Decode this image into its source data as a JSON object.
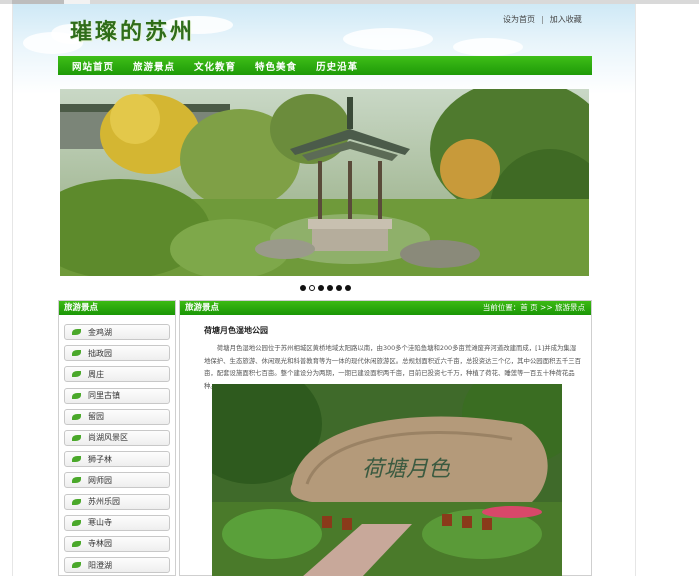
{
  "header": {
    "logo_text": "璀璨的苏州",
    "top_links": [
      "设为首页",
      "|",
      "加入收藏"
    ]
  },
  "nav": {
    "items": [
      "网站首页",
      "旅游景点",
      "文化教育",
      "特色美食",
      "历史沿革"
    ]
  },
  "slider": {
    "dot_count": 6,
    "active_index": 1
  },
  "sidebar": {
    "title": "旅游景点",
    "items": [
      "金鸡湖",
      "拙政园",
      "周庄",
      "同里古镇",
      "留园",
      "尚湖风景区",
      "狮子林",
      "网师园",
      "苏州乐园",
      "寒山寺",
      "寺林园",
      "阳澄湖"
    ]
  },
  "content": {
    "title": "旅游景点",
    "breadcrumb": "当前位置：首 页 >> 旅游景点",
    "article_title": "荷塘月色湿地公园",
    "article_body": "荷塘月色湿地公园位于苏州相城区黄桥地域太阳路以南，由300多个洼陷鱼塘和200多亩荒滩废弃河道改建而成，[1]并成为集湿地保护、生态旅游、休闲观光和科普教育等为一体的现代休闲旅游区。总规划面积近六千亩，总投资达三个亿，其中公园面积五千三百亩，配套设施面积七百亩。整个建设分为两期，一期已建设面积两千亩，目前已投资七千万，种植了荷花、睡莲等一百五十种荷花品种。",
    "stone_inscription": "荷塘月色"
  },
  "colors": {
    "nav_green": "#1e9a08",
    "logo_green": "#2f6d1a",
    "leaf_green": "#4aa82a"
  }
}
